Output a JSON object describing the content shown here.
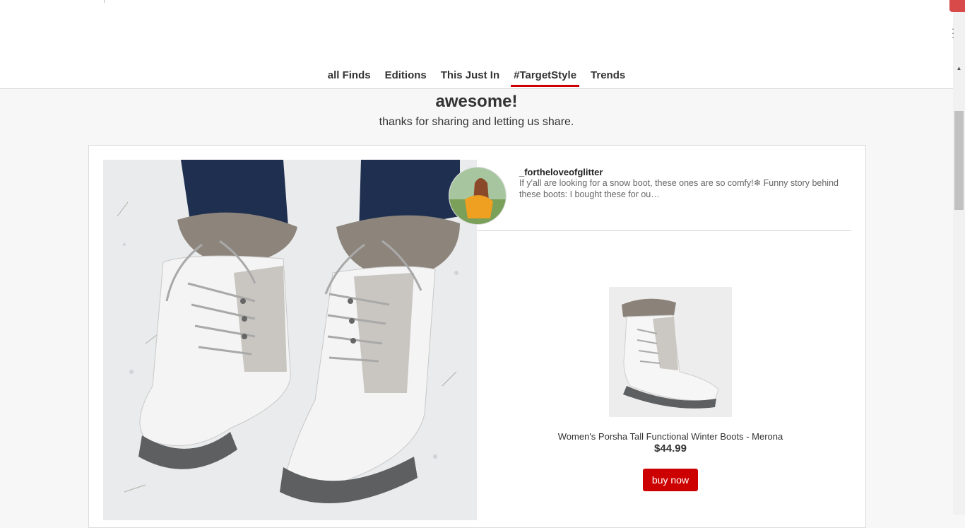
{
  "nav": {
    "items": [
      {
        "label": "all Finds"
      },
      {
        "label": "Editions"
      },
      {
        "label": "This Just In"
      },
      {
        "label": "#TargetStyle",
        "active": true
      },
      {
        "label": "Trends"
      }
    ]
  },
  "heading": {
    "title": "awesome!",
    "subtitle": "thanks for sharing and letting us share."
  },
  "post": {
    "username": "_fortheloveofglitter",
    "caption": "If y'all are looking for a snow boot, these ones are so comfy!❄ Funny story behind these boots: I bought these for ou…"
  },
  "product": {
    "name": "Women's Porsha Tall Functional Winter Boots - Merona",
    "price": "$44.99",
    "buy_label": "buy now"
  },
  "colors": {
    "accent": "#cc0000",
    "background": "#f7f7f7"
  },
  "icons": [
    "scroll-up-icon",
    "kebab-menu-icon"
  ]
}
